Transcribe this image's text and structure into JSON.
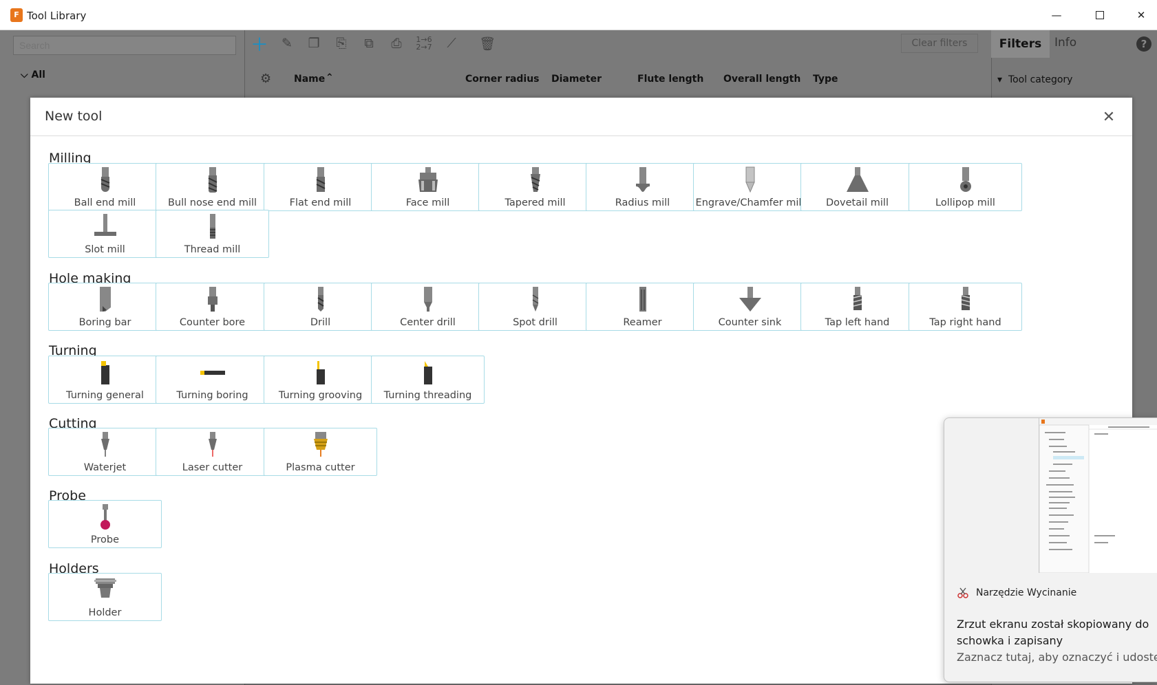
{
  "window": {
    "title": "Tool Library",
    "icon_letter": "F"
  },
  "toolbar": {
    "clear_filters": "Clear filters"
  },
  "left_pane": {
    "search_placeholder": "Search",
    "tree_root": "All"
  },
  "table": {
    "columns": [
      "Name",
      "Corner radius",
      "Diameter",
      "Flute length",
      "Overall length",
      "Type"
    ]
  },
  "right_pane": {
    "tabs": [
      "Filters",
      "Info"
    ],
    "help": "?",
    "section": "Tool category"
  },
  "dialog": {
    "title": "New tool",
    "categories": [
      {
        "name": "Milling",
        "tools": [
          "Ball end mill",
          "Bull nose end mill",
          "Flat end mill",
          "Face mill",
          "Tapered mill",
          "Radius mill",
          "Engrave/Chamfer mill",
          "Dovetail mill",
          "Lollipop mill",
          "Slot mill",
          "Thread mill"
        ]
      },
      {
        "name": "Hole making",
        "tools": [
          "Boring bar",
          "Counter bore",
          "Drill",
          "Center drill",
          "Spot drill",
          "Reamer",
          "Counter sink",
          "Tap left hand",
          "Tap right hand"
        ]
      },
      {
        "name": "Turning",
        "tools": [
          "Turning general",
          "Turning boring",
          "Turning grooving",
          "Turning threading"
        ]
      },
      {
        "name": "Cutting",
        "tools": [
          "Waterjet",
          "Laser cutter",
          "Plasma cutter"
        ]
      },
      {
        "name": "Probe",
        "tools": [
          "Probe"
        ]
      },
      {
        "name": "Holders",
        "tools": [
          "Holder"
        ]
      }
    ]
  },
  "toast": {
    "app_name": "Narzędzie Wycinanie",
    "message": "Zrzut ekranu został skopiowany do schowka i zapisany",
    "sub": "Zaznacz tutaj, aby oznaczyć i udostępnić"
  },
  "colors": {
    "tile_border": "#a7dbe6",
    "accent": "#1aa0c4",
    "probe_ball": "#c2185b",
    "insert": "#f5c400"
  }
}
